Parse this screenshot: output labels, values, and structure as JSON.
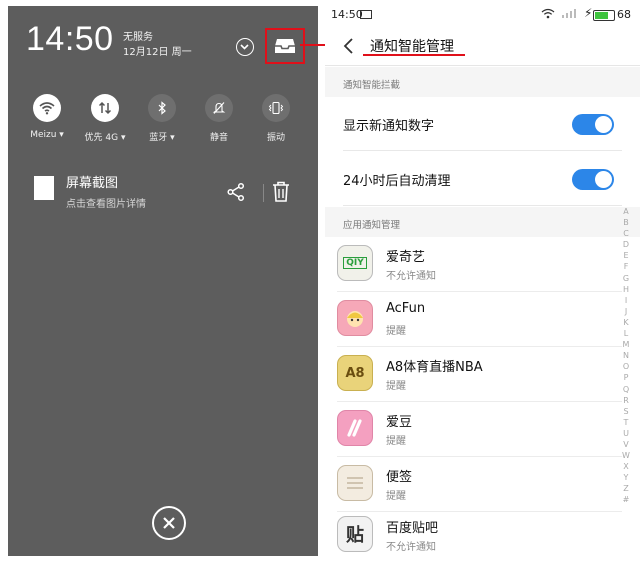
{
  "left_panel": {
    "time": "14:50",
    "carrier": "无服务",
    "date": "12月12日 周一",
    "quick_settings": [
      {
        "label": "Meizu",
        "icon": "wifi-icon",
        "on": true
      },
      {
        "label": "优先 4G",
        "icon": "data-transfer-icon",
        "on": true
      },
      {
        "label": "蓝牙",
        "icon": "bluetooth-icon",
        "on": false
      },
      {
        "label": "静音",
        "icon": "mute-icon",
        "on": false
      },
      {
        "label": "振动",
        "icon": "vibrate-icon",
        "on": false
      }
    ],
    "notification": {
      "title": "屏幕截图",
      "subtitle": "点击查看图片详情"
    }
  },
  "right_panel": {
    "status_bar": {
      "time": "14:50",
      "battery": "68"
    },
    "header": {
      "title": "通知智能管理"
    },
    "section1": {
      "title": "通知智能拦截",
      "toggles": [
        {
          "label": "显示新通知数字",
          "on": true
        },
        {
          "label": "24小时后自动清理",
          "on": true
        }
      ]
    },
    "section2": {
      "title": "应用通知管理",
      "apps": [
        {
          "name": "爱奇艺",
          "status": "不允许通知",
          "icon_text": "QIY"
        },
        {
          "name": "AcFun",
          "status": "提醒",
          "icon_text": ""
        },
        {
          "name": "A8体育直播NBA",
          "status": "提醒",
          "icon_text": "A8"
        },
        {
          "name": "爱豆",
          "status": "提醒",
          "icon_text": ""
        },
        {
          "name": "便签",
          "status": "提醒",
          "icon_text": ""
        },
        {
          "name": "百度贴吧",
          "status": "不允许通知",
          "icon_text": "贴"
        }
      ]
    },
    "alphabet": [
      "A",
      "B",
      "C",
      "D",
      "E",
      "F",
      "G",
      "H",
      "I",
      "J",
      "K",
      "L",
      "M",
      "N",
      "O",
      "P",
      "Q",
      "R",
      "S",
      "T",
      "U",
      "V",
      "W",
      "X",
      "Y",
      "Z",
      "#"
    ]
  },
  "colors": {
    "accent": "#2c86e8",
    "highlight": "#e0101a",
    "panel_bg": "#5d5d5d"
  }
}
